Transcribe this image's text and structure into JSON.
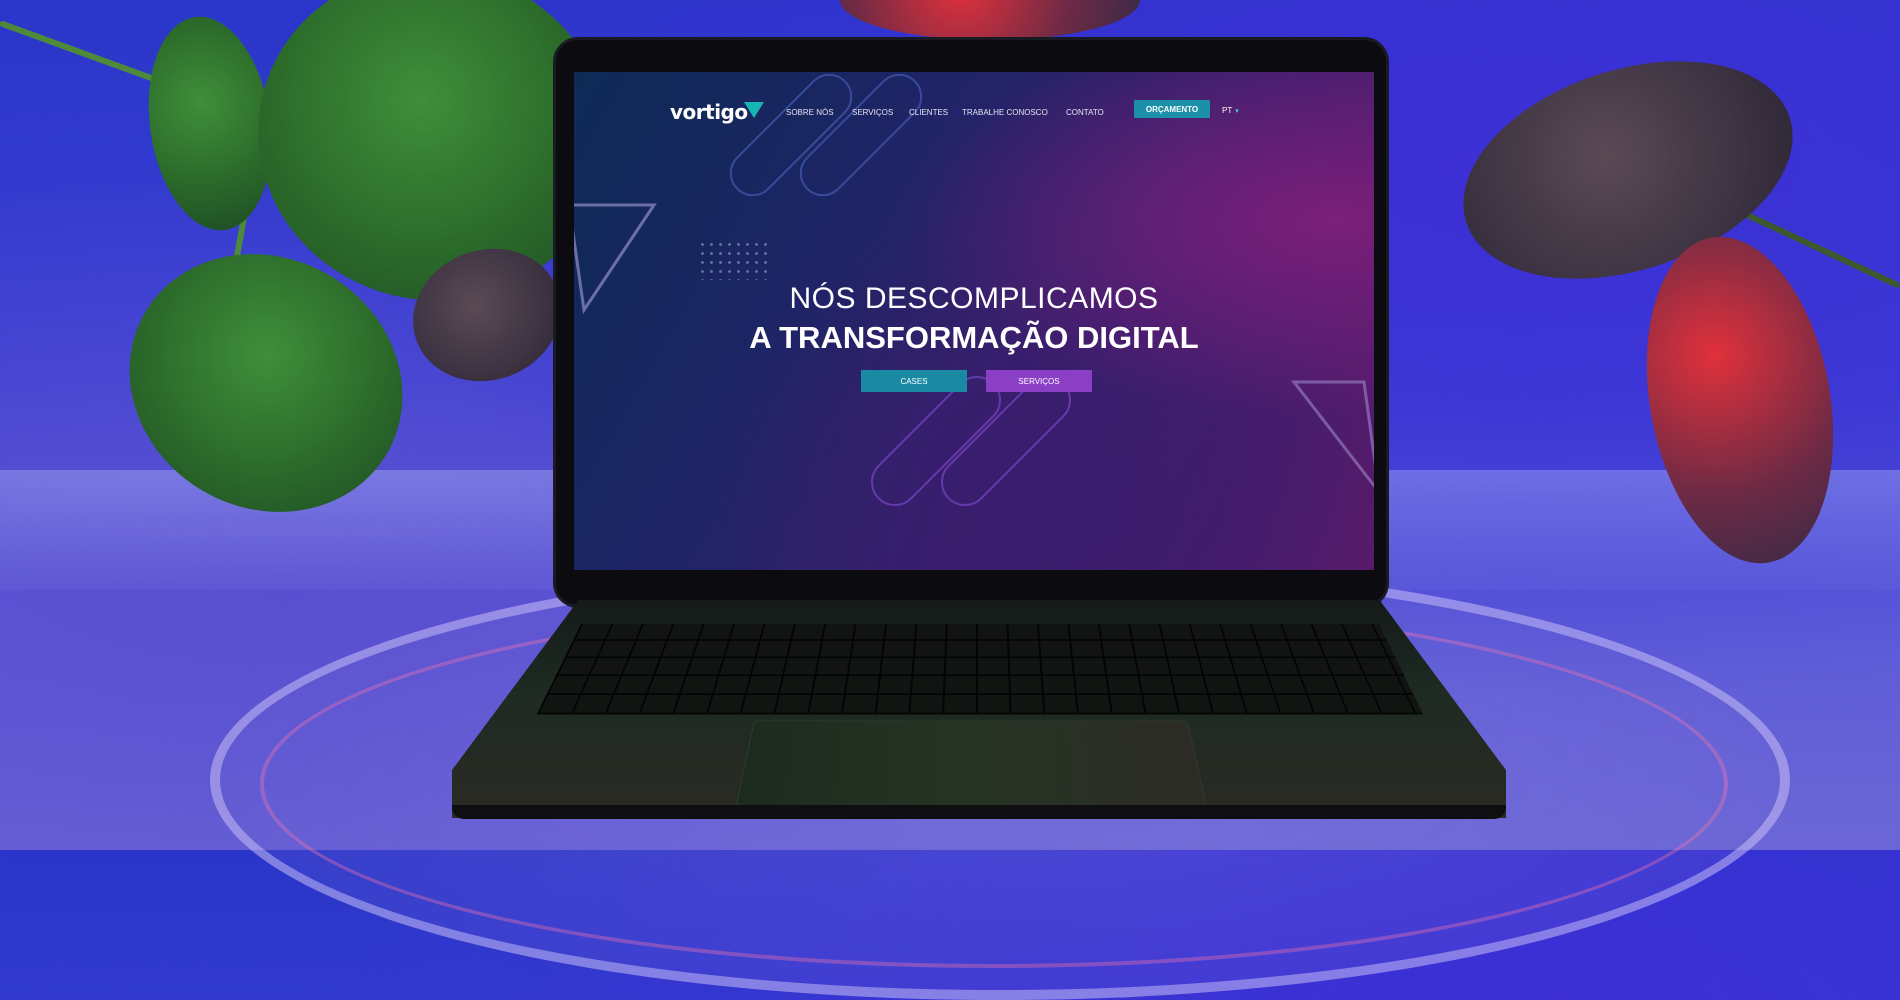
{
  "website": {
    "logo_text": "vortigo",
    "nav": [
      "SOBRE NÓS",
      "SERVIÇOS",
      "CLIENTES",
      "TRABALHE CONOSCO",
      "CONTATO"
    ],
    "cta": "ORÇAMENTO",
    "language": "PT",
    "hero_line1": "NÓS DESCOMPLICAMOS",
    "hero_line2": "A TRANSFORMAÇÃO DIGITAL",
    "buttons": {
      "cases": "CASES",
      "services": "SERVIÇOS"
    }
  },
  "colors": {
    "brand_teal": "#1b90a8",
    "brand_purple": "#8a3fc4",
    "background_blue": "#2a36c9"
  }
}
